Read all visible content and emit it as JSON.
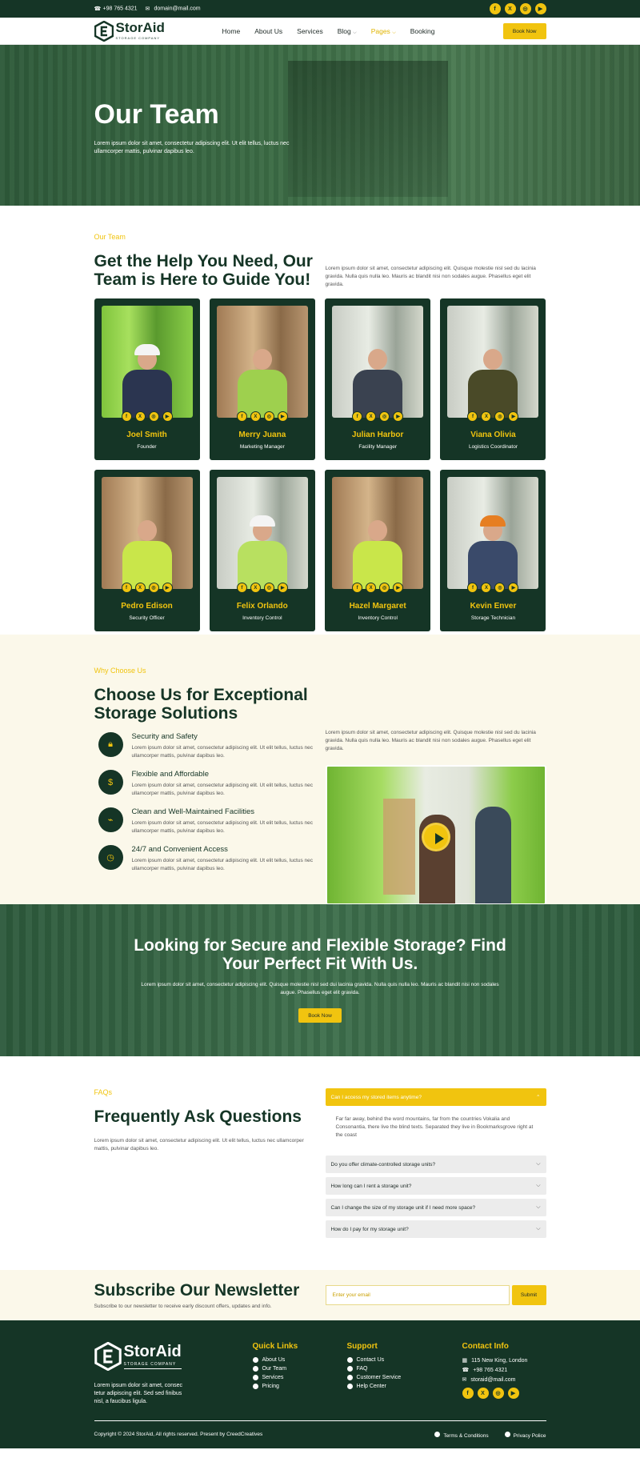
{
  "topbar": {
    "phone": "+98 765 4321",
    "email": "domain@mail.com",
    "social": [
      "f",
      "X",
      "◎",
      "▶"
    ]
  },
  "nav": {
    "logo_main": "StorAid",
    "logo_sub": "STORAGE COMPANY",
    "items": [
      {
        "label": "Home"
      },
      {
        "label": "About Us"
      },
      {
        "label": "Services"
      },
      {
        "label": "Blog",
        "dropdown": true
      },
      {
        "label": "Pages",
        "dropdown": true,
        "active": true
      },
      {
        "label": "Booking"
      }
    ],
    "book_label": "Book Now"
  },
  "hero": {
    "title": "Our Team",
    "text": "Lorem ipsum dolor sit amet, consectetur adipiscing elit. Ut elit tellus, luctus nec ullamcorper mattis, pulvinar dapibus leo."
  },
  "team": {
    "kicker": "Our Team",
    "title": "Get the Help You Need, Our Team is Here to Guide You!",
    "text": "Lorem ipsum dolor sit amet, consectetur adipiscing elit. Quisque molestie nisl sed du lacinia gravida. Nulla quis nulla leo. Mauris ac blandit nisi non sodales augue. Phasellus eget elit gravida.",
    "members": [
      {
        "name": "Joel Smith",
        "role": "Founder"
      },
      {
        "name": "Merry Juana",
        "role": "Marketing Manager"
      },
      {
        "name": "Julian Harbor",
        "role": "Facility Manager"
      },
      {
        "name": "Viana Olivia",
        "role": "Logistics Coordinator"
      },
      {
        "name": "Pedro Edison",
        "role": "Security Officer"
      },
      {
        "name": "Felix Orlando",
        "role": "Inventory Control"
      },
      {
        "name": "Hazel Margaret",
        "role": "Inventory Control"
      },
      {
        "name": "Kevin Enver",
        "role": "Storage Technician"
      }
    ]
  },
  "why": {
    "kicker": "Why Choose Us",
    "title": "Choose Us for Exceptional Storage Solutions",
    "text": "Lorem ipsum dolor sit amet, consectetur adipiscing elit. Quisque molestie nisl sed du lacinia gravida. Nulla quis nulla leo. Mauris ac blandit nisi non sodales augue. Phasellus eget elit gravida.",
    "features": [
      {
        "title": "Security and Safety",
        "text": "Lorem ipsum dolor sit amet, consectetur adipiscing elit. Ut elit tellus, luctus nec ullamcorper mattis, pulvinar dapibus leo."
      },
      {
        "title": "Flexible and Affordable",
        "text": "Lorem ipsum dolor sit amet, consectetur adipiscing elit. Ut elit tellus, luctus nec ullamcorper mattis, pulvinar dapibus leo."
      },
      {
        "title": "Clean and Well-Maintained Facilities",
        "text": "Lorem ipsum dolor sit amet, consectetur adipiscing elit. Ut elit tellus, luctus nec ullamcorper mattis, pulvinar dapibus leo."
      },
      {
        "title": "24/7 and Convenient Access",
        "text": "Lorem ipsum dolor sit amet, consectetur adipiscing elit. Ut elit tellus, luctus nec ullamcorper mattis, pulvinar dapibus leo."
      }
    ]
  },
  "cta": {
    "title": "Looking for Secure and Flexible Storage? Find Your Perfect Fit With Us.",
    "text": "Lorem ipsum dolor sit amet, consectetur adipiscing elit. Quisque molestie nisl sed dui lacinia gravida. Nulla quis nulla leo. Mauris ac blandit nisi non sodales augue. Phasellus eget elit gravida.",
    "button": "Book Now"
  },
  "faq": {
    "kicker": "FAQs",
    "title": "Frequently Ask Questions",
    "text": "Lorem ipsum dolor sit amet, consectetur adipiscing elit. Ut elit tellus, luctus nec ullamcorper mattis, pulvinar dapibus leo.",
    "open_question": "Can I access my stored items anytime?",
    "open_answer": "Far far away, behind the word mountains, far from the countries Vokalia and Consonantia, there live the blind texts. Separated they live in Bookmarksgrove right at the coast",
    "questions": [
      "Do you offer climate-controlled storage units?",
      "How long can I rent a storage unit?",
      "Can I change the size of my storage unit if I need more space?",
      "How do I pay for my storage unit?"
    ]
  },
  "newsletter": {
    "title": "Subscribe Our Newsletter",
    "text": "Subscribe to our newsletter to receive early discount offers, updates and info.",
    "placeholder": "Enter your email",
    "button": "Submit"
  },
  "footer": {
    "about": "Lorem ipsum dolor sit amet, consec tetur adipiscing elit. Sed sed finibus nisl, a faucibus ligula.",
    "quick_title": "Quick Links",
    "quick": [
      "About Us",
      "Our Team",
      "Services",
      "Pricing"
    ],
    "support_title": "Support",
    "support": [
      "Contact Us",
      "FAQ",
      "Customer Service",
      "Help Center"
    ],
    "contact_title": "Contact Info",
    "contact": [
      "115 New King, London",
      "+98 765 4321",
      "storaid@mail.com"
    ],
    "copyright": "Copyright © 2024 StorAid, All rights reserved. Present by CreedCreatives",
    "terms": "Terms & Conditions",
    "privacy": "Privacy Police"
  },
  "colors": {
    "green": "#153526",
    "yellow": "#f1c40f",
    "cream": "#fbf8ea"
  }
}
